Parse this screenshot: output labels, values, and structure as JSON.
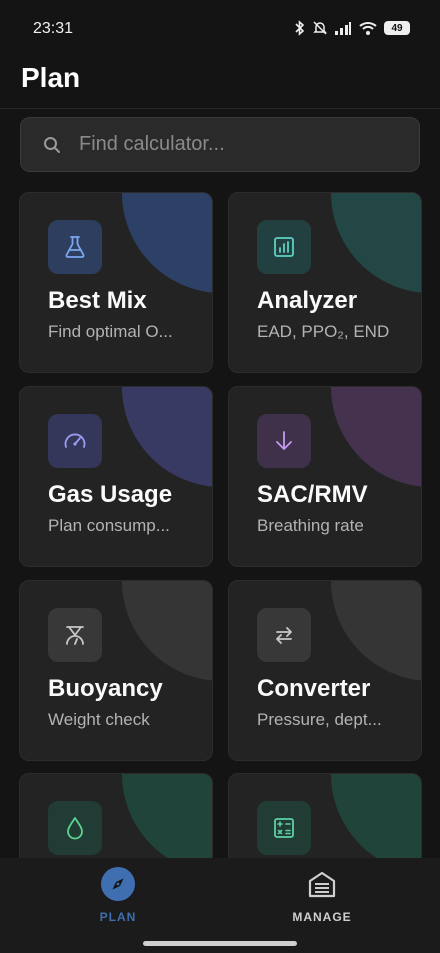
{
  "status": {
    "time": "23:31",
    "battery": "49"
  },
  "header": {
    "title": "Plan"
  },
  "search": {
    "placeholder": "Find calculator..."
  },
  "colors": {
    "accent": "#3f6fb0",
    "background": "#141414",
    "card": "#232323"
  },
  "cards": [
    {
      "title": "Best Mix",
      "subtitle": "Find optimal O...",
      "icon": "flask-icon",
      "tint": "#2d4066"
    },
    {
      "title": "Analyzer",
      "subtitle": "EAD, PPO₂, END",
      "icon": "chart-icon",
      "tint": "#234744"
    },
    {
      "title": "Gas Usage",
      "subtitle": "Plan consump...",
      "icon": "gauge-icon",
      "tint": "#383a63"
    },
    {
      "title": "SAC/RMV",
      "subtitle": "Breathing rate",
      "icon": "arrow-down-icon",
      "tint": "#45324f"
    },
    {
      "title": "Buoyancy",
      "subtitle": "Weight check",
      "icon": "scale-icon",
      "tint": "#373737"
    },
    {
      "title": "Converter",
      "subtitle": "Pressure, dept...",
      "icon": "swap-icon",
      "tint": "#373737"
    },
    {
      "title": "",
      "subtitle": "",
      "icon": "drop-icon",
      "tint": "#21443a"
    },
    {
      "title": "",
      "subtitle": "",
      "icon": "calculator-icon",
      "tint": "#21443a"
    }
  ],
  "nav": {
    "plan_label": "PLAN",
    "manage_label": "MANAGE"
  }
}
